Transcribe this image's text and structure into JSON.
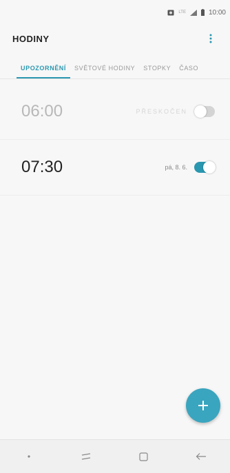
{
  "status_bar": {
    "time": "10:00",
    "network_label": "LTE"
  },
  "header": {
    "title": "HODINY"
  },
  "tabs": [
    {
      "label": "UPOZORNĚNÍ",
      "active": true
    },
    {
      "label": "SVĚTOVÉ HODINY",
      "active": false
    },
    {
      "label": "STOPKY",
      "active": false
    },
    {
      "label": "ČASO",
      "active": false
    }
  ],
  "alarms": [
    {
      "time": "06:00",
      "meta": "PŘESKOČEN",
      "enabled": false
    },
    {
      "time": "07:30",
      "meta": "pá, 8. 6.",
      "enabled": true
    }
  ],
  "colors": {
    "accent": "#2a97b0",
    "fab": "#3aa5bf"
  },
  "icons": {
    "menu": "more-vert-icon",
    "fab": "plus-icon",
    "nav_dot": "dot-icon",
    "nav_recents": "recents-icon",
    "nav_home": "home-icon",
    "nav_back": "back-icon"
  }
}
